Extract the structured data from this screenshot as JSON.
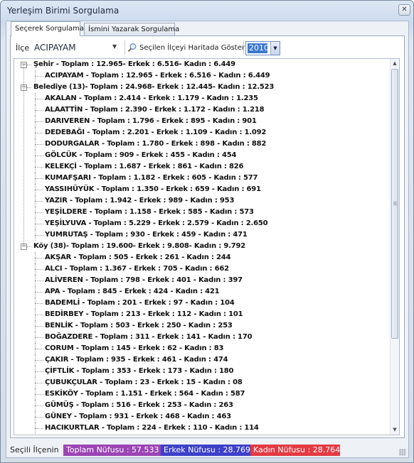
{
  "window": {
    "title": "Yerleşim Birimi Sorgulama",
    "close_glyph": "✕"
  },
  "tabs": [
    {
      "label": "Seçerek Sorgulama",
      "active": true
    },
    {
      "label": "İsmini Yazarak Sorgulama",
      "active": false
    }
  ],
  "toolbar": {
    "ilce_label": "İlçe",
    "ilce_value": "ACIPAYAM",
    "map_button_label": "Seçilen İlçeyi Haritada Göster",
    "year_value": "2010"
  },
  "tree": {
    "rows": [
      {
        "level": 0,
        "expanded": true,
        "text": "Şehir - Toplam : 12.965- Erkek : 6.516- Kadın : 6.449"
      },
      {
        "level": 1,
        "text": "ACIPAYAM - Toplam : 12.965 - Erkek : 6.516 - Kadın : 6.449"
      },
      {
        "level": 0,
        "expanded": true,
        "text": "Belediye (13)- Toplam : 24.968- Erkek : 12.445- Kadın : 12.523"
      },
      {
        "level": 1,
        "text": "AKALAN - Toplam : 2.414 - Erkek : 1.179 - Kadın : 1.235"
      },
      {
        "level": 1,
        "text": "ALAATTİN - Toplam : 2.390 - Erkek : 1.172 - Kadın : 1.218"
      },
      {
        "level": 1,
        "text": "DARIVEREN - Toplam : 1.796 - Erkek : 895 - Kadın : 901"
      },
      {
        "level": 1,
        "text": "DEDEBAĞI - Toplam : 2.201 - Erkek : 1.109 - Kadın : 1.092"
      },
      {
        "level": 1,
        "text": "DODURGALAR - Toplam : 1.780 - Erkek : 898 - Kadın : 882"
      },
      {
        "level": 1,
        "text": "GÖLCÜK - Toplam : 909 - Erkek : 455 - Kadın : 454"
      },
      {
        "level": 1,
        "text": "KELEKÇİ - Toplam : 1.687 - Erkek : 861 - Kadın : 826"
      },
      {
        "level": 1,
        "text": "KUMAFŞARI - Toplam : 1.182 - Erkek : 605 - Kadın : 577"
      },
      {
        "level": 1,
        "text": "YASSIHÜYÜK - Toplam : 1.350 - Erkek : 659 - Kadın : 691"
      },
      {
        "level": 1,
        "text": "YAZIR - Toplam : 1.942 - Erkek : 989 - Kadın : 953"
      },
      {
        "level": 1,
        "text": "YEŞİLDERE - Toplam : 1.158 - Erkek : 585 - Kadın : 573"
      },
      {
        "level": 1,
        "text": "YEŞİLYUVA - Toplam : 5.229 - Erkek : 2.579 - Kadın : 2.650"
      },
      {
        "level": 1,
        "text": "YUMRUTAŞ - Toplam : 930 - Erkek : 459 - Kadın : 471"
      },
      {
        "level": 0,
        "expanded": true,
        "text": "Köy (38)- Toplam : 19.600- Erkek : 9.808- Kadın : 9.792"
      },
      {
        "level": 1,
        "text": "AKŞAR - Toplam : 505 - Erkek : 261 - Kadın : 244"
      },
      {
        "level": 1,
        "text": "ALCI - Toplam : 1.367 - Erkek : 705 - Kadın : 662"
      },
      {
        "level": 1,
        "text": "ALİVEREN - Toplam : 798 - Erkek : 401 - Kadın : 397"
      },
      {
        "level": 1,
        "text": "APA - Toplam : 845 - Erkek : 424 - Kadın : 421"
      },
      {
        "level": 1,
        "text": "BADEMLİ - Toplam : 201 - Erkek : 97 - Kadın : 104"
      },
      {
        "level": 1,
        "text": "BEDİRBEY - Toplam : 213 - Erkek : 112 - Kadın : 101"
      },
      {
        "level": 1,
        "text": "BENLİK - Toplam : 503 - Erkek : 250 - Kadın : 253"
      },
      {
        "level": 1,
        "text": "BOĞAZDERE - Toplam : 311 - Erkek : 141 - Kadın : 170"
      },
      {
        "level": 1,
        "text": "CORUM - Toplam : 145 - Erkek : 62 - Kadın : 83"
      },
      {
        "level": 1,
        "text": "ÇAKIR - Toplam : 935 - Erkek : 461 - Kadın : 474"
      },
      {
        "level": 1,
        "text": "ÇİFTLİK - Toplam : 353 - Erkek : 173 - Kadın : 180"
      },
      {
        "level": 1,
        "text": "ÇUBUKÇULAR - Toplam : 23 - Erkek : 15 - Kadın : 08"
      },
      {
        "level": 1,
        "text": "ESKİKÖY - Toplam : 1.151 - Erkek : 564 - Kadın : 587"
      },
      {
        "level": 1,
        "text": "GÜMÜŞ - Toplam : 516 - Erkek : 253 - Kadın : 263"
      },
      {
        "level": 1,
        "text": "GÜNEY - Toplam : 931 - Erkek : 468 - Kadın : 463"
      },
      {
        "level": 1,
        "text": "HACIKURTLAR - Toplam : 224 - Erkek : 110 - Kadın : 114"
      }
    ]
  },
  "status": {
    "label": "Seçili İlçenin",
    "total": "Toplam Nüfusu : 57.533",
    "erkek": "Erkek Nüfusu : 28.769",
    "kadin": "Kadın Nüfusu : 28.764",
    "colors": {
      "total": "#9b45b4",
      "erkek": "#3d40c8",
      "kadin": "#e33a43"
    }
  }
}
